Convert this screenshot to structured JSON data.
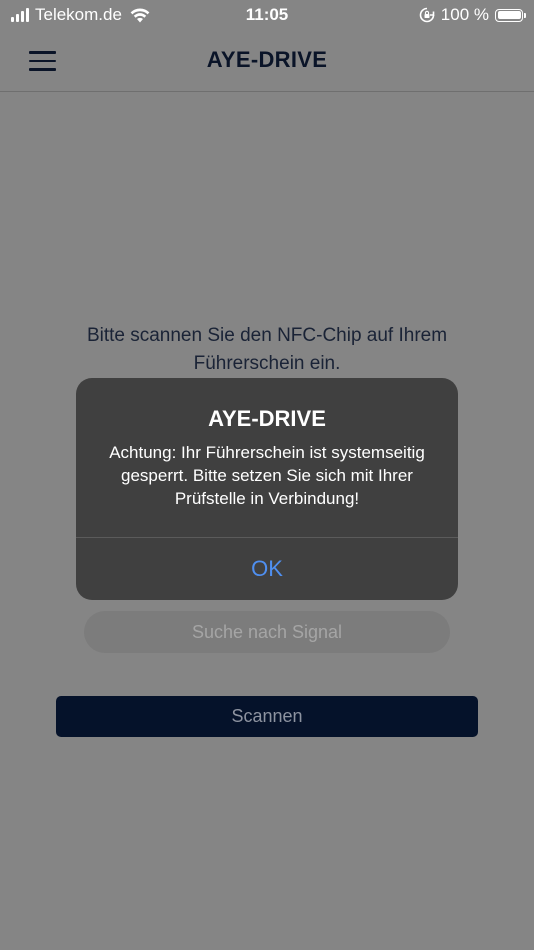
{
  "status_bar": {
    "carrier": "Telekom.de",
    "time": "11:05",
    "battery": "100 %",
    "battery_level": 1.0,
    "icons": [
      "signal-icon",
      "wifi-icon",
      "rotation-lock-icon",
      "battery-icon"
    ]
  },
  "header": {
    "title": "AYE-DRIVE",
    "menu_icon": "hamburger-menu-icon"
  },
  "main": {
    "instruction": "Bitte scannen Sie den NFC-Chip auf Ihrem Führerschein ein.",
    "signal_status": "Suche nach Signal",
    "scan_label": "Scannen"
  },
  "alert": {
    "title": "AYE-DRIVE",
    "message": "Achtung: Ihr Führerschein ist systemseitig gesperrt. Bitte setzen Sie sich mit Ihrer Prüfstelle in Verbindung!",
    "ok_label": "OK"
  },
  "colors": {
    "navy": "#0a1428",
    "alert_background": "#404040",
    "link_blue": "#4f8ff0"
  }
}
